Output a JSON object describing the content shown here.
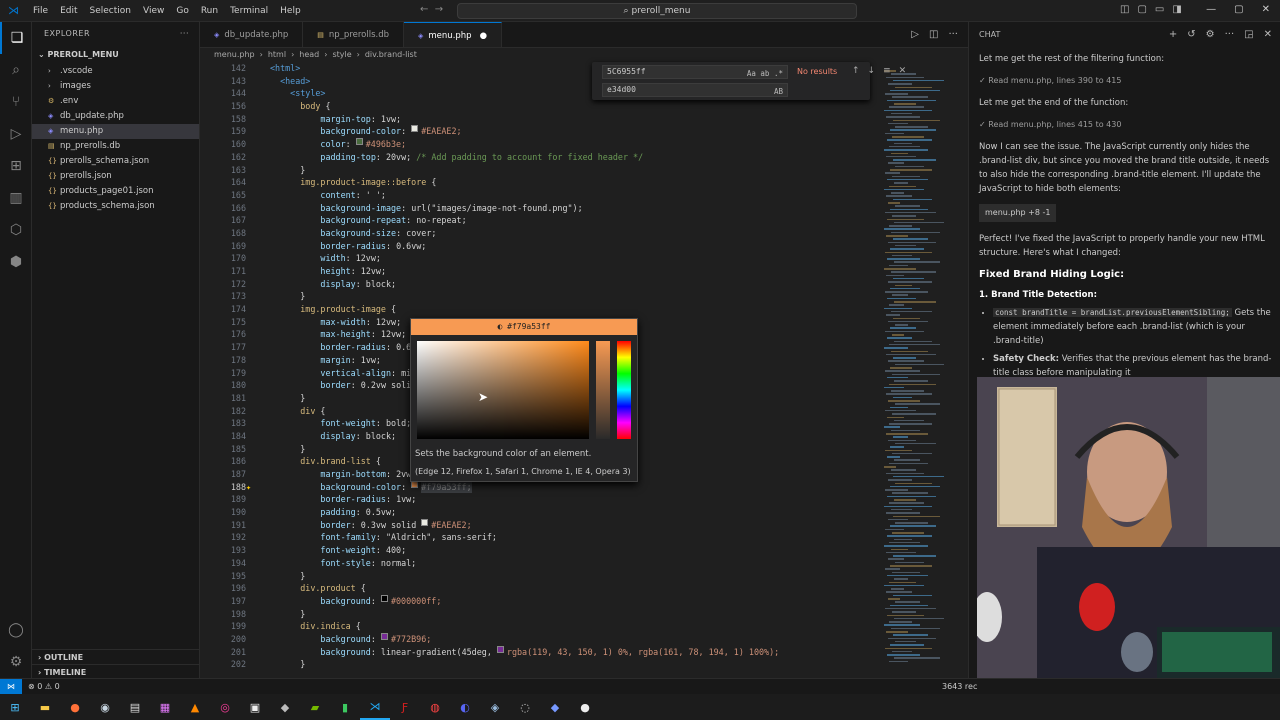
{
  "titlebar": {
    "menu": [
      "File",
      "Edit",
      "Selection",
      "View",
      "Go",
      "Run",
      "Terminal",
      "Help"
    ],
    "command_center": "preroll_menu"
  },
  "explorer": {
    "header": "EXPLORER",
    "project": "PREROLL_MENU",
    "items": [
      {
        "label": ".vscode",
        "icon": "chevron-right-icon",
        "indent": 1
      },
      {
        "label": "images",
        "icon": "chevron-right-icon",
        "indent": 1
      },
      {
        "label": ".env",
        "icon": "gear-icon",
        "indent": 1
      },
      {
        "label": "db_update.php",
        "icon": "php-file-icon",
        "indent": 1
      },
      {
        "label": "menu.php",
        "icon": "php-file-icon",
        "indent": 1,
        "selected": true
      },
      {
        "label": "np_prerolls.db",
        "icon": "database-file-icon",
        "indent": 1
      },
      {
        "label": "prerolls_schema.json",
        "icon": "json-file-icon",
        "indent": 1
      },
      {
        "label": "prerolls.json",
        "icon": "json-file-icon",
        "indent": 1
      },
      {
        "label": "products_page01.json",
        "icon": "json-file-icon",
        "indent": 1
      },
      {
        "label": "products_schema.json",
        "icon": "json-file-icon",
        "indent": 1
      }
    ],
    "outline": "OUTLINE",
    "timeline": "TIMELINE"
  },
  "tabs": [
    {
      "label": "db_update.php",
      "active": false
    },
    {
      "label": "np_prerolls.db",
      "active": false
    },
    {
      "label": "menu.php",
      "active": true,
      "dirty": true
    }
  ],
  "breadcrumb": [
    "menu.php",
    "html",
    "head",
    "style",
    "div.brand-list"
  ],
  "find": {
    "search_value": "5C6955ff",
    "replace_value": "e34d00",
    "status": "No results",
    "search_opts": "Aa ab .*",
    "replace_opts": "AB"
  },
  "code_lines": [
    {
      "n": "142",
      "t": "<html>"
    },
    {
      "n": "143",
      "t": "  <head>"
    },
    {
      "n": "144",
      "t": "    <style>"
    },
    {
      "n": "156",
      "t": "      body {"
    },
    {
      "n": "158",
      "t": "          margin-top: 1vw;"
    },
    {
      "n": "159",
      "t": "          background-color: ",
      "sw": "#EAEAE2",
      "a": "#EAEAE2;"
    },
    {
      "n": "160",
      "t": "          color: ",
      "sw": "#496b3e",
      "a": "#496b3e;"
    },
    {
      "n": "162",
      "t": "          padding-top: 20vw; /* Add padding to account for fixed header */"
    },
    {
      "n": "163",
      "t": "      }"
    },
    {
      "n": "164",
      "t": "      img.product-image::before {"
    },
    {
      "n": "165",
      "t": "          content: ' ';"
    },
    {
      "n": "166",
      "t": "          background-image: url(\"images/image-not-found.png\");"
    },
    {
      "n": "167",
      "t": "          background-repeat: no-repeat;"
    },
    {
      "n": "168",
      "t": "          background-size: cover;"
    },
    {
      "n": "169",
      "t": "          border-radius: 0.6vw;"
    },
    {
      "n": "170",
      "t": "          width: 12vw;"
    },
    {
      "n": "171",
      "t": "          height: 12vw;"
    },
    {
      "n": "172",
      "t": "          display: block;"
    },
    {
      "n": "173",
      "t": "      }"
    },
    {
      "n": "174",
      "t": "      img.product-image {"
    },
    {
      "n": "175",
      "t": "          max-width: 12vw;"
    },
    {
      "n": "176",
      "t": "          max-height: 12vw;"
    },
    {
      "n": "177",
      "t": "          border-radius: 0.6v"
    },
    {
      "n": "178",
      "t": "          margin: 1vw;"
    },
    {
      "n": "179",
      "t": "          vertical-align: mic"
    },
    {
      "n": "180",
      "t": "          border: 0.2vw soli"
    },
    {
      "n": "181",
      "t": "      }"
    },
    {
      "n": "182",
      "t": "      div {"
    },
    {
      "n": "183",
      "t": "          font-weight: bold;"
    },
    {
      "n": "184",
      "t": "          display: block;"
    },
    {
      "n": "185",
      "t": "      }"
    },
    {
      "n": "186",
      "t": "      div.brand-list {"
    },
    {
      "n": "187",
      "t": "          margin-bottom: 2vw;"
    },
    {
      "n": "188",
      "t": "          background-color: ",
      "sw": "#f79a53",
      "a": "#f79a53ff;",
      "cur": true
    },
    {
      "n": "189",
      "t": "          border-radius: 1vw;"
    },
    {
      "n": "190",
      "t": "          padding: 0.5vw;"
    },
    {
      "n": "191",
      "t": "          border: 0.3vw solid ",
      "sw": "#EAEAE2",
      "a": "#EAEAE2;"
    },
    {
      "n": "192",
      "t": "          font-family: \"Aldrich\", sans-serif;"
    },
    {
      "n": "193",
      "t": "          font-weight: 400;"
    },
    {
      "n": "194",
      "t": "          font-style: normal;"
    },
    {
      "n": "195",
      "t": "      }"
    },
    {
      "n": "196",
      "t": "      div.product {"
    },
    {
      "n": "197",
      "t": "          background: ",
      "sw": "#000000",
      "a": "#000000ff;"
    },
    {
      "n": "198",
      "t": "      }"
    },
    {
      "n": "199",
      "t": "      div.indica {"
    },
    {
      "n": "200",
      "t": "          background: ",
      "sw": "#772B96",
      "a": "#772B96;"
    },
    {
      "n": "201",
      "t": "          background: linear-gradient(45deg, ",
      "sw": "#772b96",
      "a": "rgba(119, 43, 150, 1) 0%, rgba(161, 78, 194, 1) 100%);"
    },
    {
      "n": "202",
      "t": "      }"
    }
  ],
  "color_picker": {
    "value": "#f79a53ff",
    "description": "Sets the background color of an element.",
    "compat": "(Edge 12, Firefox 1, Safari 1, Chrome 1, IE 4, Opera 3)"
  },
  "chat": {
    "header": "CHAT",
    "p1": "Let me get the rest of the filtering function:",
    "tool1": "Read  menu.php, lines 390 to 415",
    "p2": "Let me get the end of the function:",
    "tool2": "Read  menu.php, lines 415 to 430",
    "p3": "Now I can see the issue. The JavaScript currently only hides the .brand-list div, but since you moved the brand title outside, it needs to also hide the corresponding .brand-title element. I'll update the JavaScript to hide both elements:",
    "chip": "menu.php +8 -1",
    "p4": "Perfect! I've fixed the JavaScript to properly handle your new HTML structure. Here's what I changed:",
    "h3": "Fixed Brand Hiding Logic:",
    "h4": "1. Brand Title Detection:",
    "li1_code": "const brandTitle = brandList.previousElementSibling;",
    "li1_text": " Gets the element immediately before each .brand-list (which is your .brand-title)",
    "li2_bold": "Safety Check:",
    "li2_text": " Verifies that the previous element has the brand-title class before manipulating it"
  },
  "statusbar": {
    "errors": "⊗ 0 ⚠ 0",
    "right": "3643 rec"
  }
}
